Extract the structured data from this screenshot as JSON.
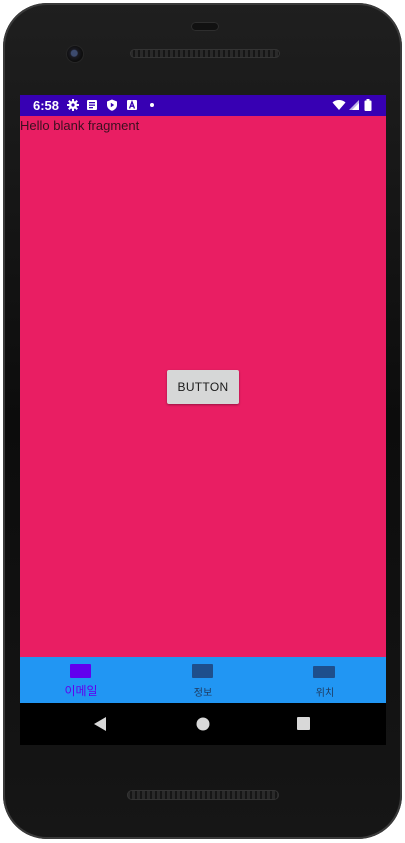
{
  "status_bar": {
    "time": "6:58",
    "left_icons": [
      "gear-icon",
      "notes-icon",
      "shield-play-icon",
      "a-icon",
      "dot-icon"
    ],
    "right_icons": [
      "wifi-icon",
      "signal-icon",
      "battery-icon"
    ],
    "color": "#3700B3"
  },
  "fragment": {
    "text": "Hello blank fragment",
    "background": "#E91E63"
  },
  "button": {
    "label": "BUTTON"
  },
  "bottom_nav": {
    "background": "#2196F3",
    "items": [
      {
        "label": "이메일",
        "icon": "email-tab-icon",
        "selected": true
      },
      {
        "label": "정보",
        "icon": "info-tab-icon",
        "selected": false
      },
      {
        "label": "위치",
        "icon": "location-tab-icon",
        "selected": false
      }
    ],
    "active_color": "#6200EE"
  },
  "system_nav": {
    "buttons": [
      "back-icon",
      "home-icon",
      "recents-icon"
    ]
  }
}
